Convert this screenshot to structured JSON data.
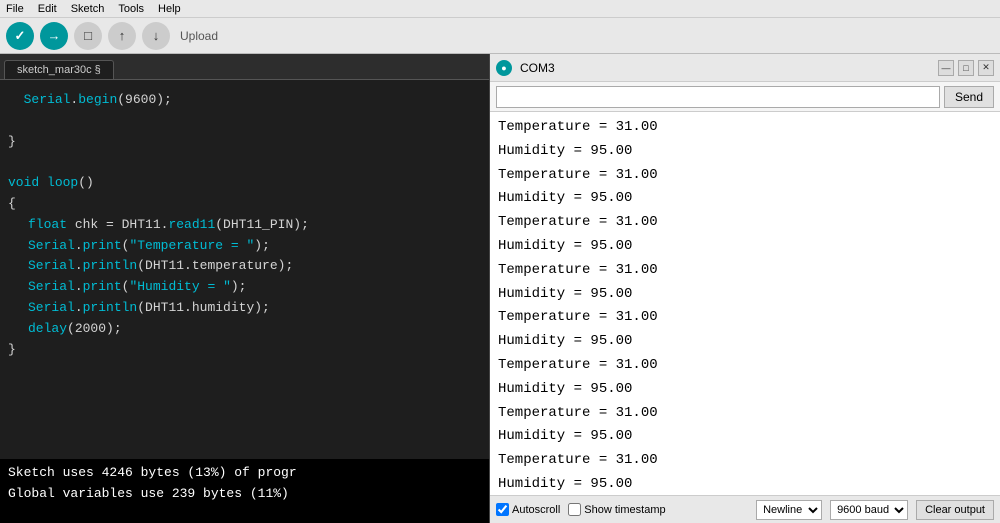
{
  "menubar": {
    "items": [
      "File",
      "Edit",
      "Sketch",
      "Tools",
      "Help"
    ]
  },
  "toolbar": {
    "upload_label": "Upload",
    "buttons": {
      "verify": "✓",
      "upload": "→",
      "new": "□",
      "open": "↑",
      "save": "↓"
    }
  },
  "tab": {
    "name": "sketch_mar30c §"
  },
  "code": {
    "lines": [
      {
        "indent": 0,
        "text": "Serial.begin(9600);",
        "type": "code"
      },
      {
        "indent": 0,
        "text": "",
        "type": "plain"
      },
      {
        "indent": 0,
        "text": "}",
        "type": "plain"
      },
      {
        "indent": 0,
        "text": "",
        "type": "plain"
      },
      {
        "indent": 0,
        "text": "void loop()",
        "type": "code"
      },
      {
        "indent": 0,
        "text": "{",
        "type": "plain"
      },
      {
        "indent": 1,
        "text": "float chk = DHT11.read11(DHT11_PIN);",
        "type": "code"
      },
      {
        "indent": 1,
        "text": "Serial.print(\"Temperature = \");",
        "type": "code"
      },
      {
        "indent": 1,
        "text": "Serial.println(DHT11.temperature);",
        "type": "code"
      },
      {
        "indent": 1,
        "text": "Serial.print(\"Humidity = \");",
        "type": "code"
      },
      {
        "indent": 1,
        "text": "Serial.println(DHT11.humidity);",
        "type": "code"
      },
      {
        "indent": 1,
        "text": "delay(2000);",
        "type": "code"
      },
      {
        "indent": 0,
        "text": "}",
        "type": "plain"
      }
    ]
  },
  "console": {
    "lines": [
      "Sketch uses 4246 bytes (13%) of progr",
      "Global variables use 239 bytes (11%)"
    ]
  },
  "serial": {
    "title": "COM3",
    "send_label": "Send",
    "input_value": "",
    "output_lines": [
      "Temperature = 31.00",
      "Humidity = 95.00",
      "Temperature = 31.00",
      "Humidity = 95.00",
      "Temperature = 31.00",
      "Humidity = 95.00",
      "Temperature = 31.00",
      "Humidity = 95.00",
      "Temperature = 31.00",
      "Humidity = 95.00",
      "Temperature = 31.00",
      "Humidity = 95.00",
      "Temperature = 31.00",
      "Humidity = 95.00",
      "Temperature = 31.00",
      "Humidity = 95.00"
    ],
    "footer": {
      "autoscroll_label": "Autoscroll",
      "timestamp_label": "Show timestamp",
      "newline_option": "Newline",
      "baud_option": "9600 baud",
      "clear_label": "Clear output"
    }
  }
}
